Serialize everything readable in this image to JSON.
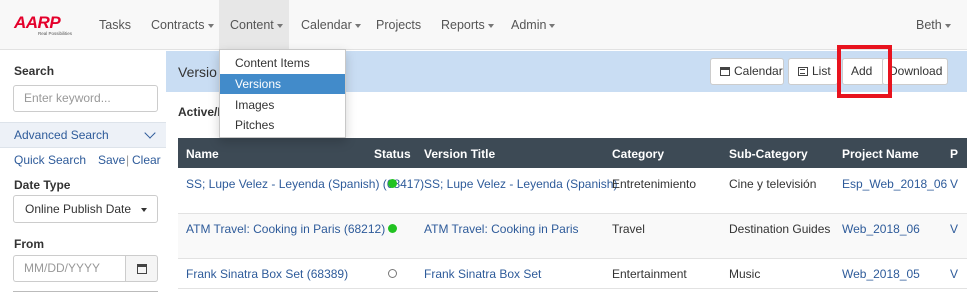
{
  "app": {
    "logo_text": "AARP",
    "logo_tagline": "Real Possibilities"
  },
  "nav": {
    "items": [
      {
        "label": "Tasks",
        "has_caret": false
      },
      {
        "label": "Contracts",
        "has_caret": true
      },
      {
        "label": "Content",
        "has_caret": true,
        "active": true
      },
      {
        "label": "Calendar",
        "has_caret": true
      },
      {
        "label": "Projects",
        "has_caret": false
      },
      {
        "label": "Reports",
        "has_caret": true
      },
      {
        "label": "Admin",
        "has_caret": true
      }
    ],
    "user": {
      "label": "Beth"
    }
  },
  "content_menu": {
    "items": [
      {
        "label": "Content Items"
      },
      {
        "label": "Versions",
        "selected": true
      },
      {
        "label": "Images"
      },
      {
        "label": "Pitches"
      }
    ]
  },
  "sidebar": {
    "search_label": "Search",
    "search_placeholder": "Enter keyword...",
    "advanced_search": "Advanced Search",
    "quick_search": "Quick Search",
    "save": "Save",
    "separator": "|",
    "clear": "Clear",
    "date_type_label": "Date Type",
    "date_type_value": "Online Publish Date",
    "from_label": "From",
    "from_placeholder": "MM/DD/YYYY"
  },
  "main": {
    "title": "Versio",
    "section_label": "Active/I",
    "toolbar": {
      "calendar": "Calendar",
      "list": "List",
      "add": "Add",
      "download": "Download"
    },
    "highlight_color": "#e8131e"
  },
  "table": {
    "columns": [
      "Name",
      "Status",
      "Version Title",
      "Category",
      "Sub-Category",
      "Project Name",
      "P"
    ],
    "rows": [
      {
        "name": "SS; Lupe Velez - Leyenda (Spanish) (68417)",
        "status": "active",
        "version_title": "SS; Lupe Velez - Leyenda (Spanish)",
        "category": "Entretenimiento",
        "sub_category": "Cine y televisión",
        "project_name": "Esp_Web_2018_06",
        "extra": "V"
      },
      {
        "name": "ATM Travel: Cooking in Paris (68212)",
        "status": "active",
        "version_title": "ATM Travel: Cooking in Paris",
        "category": "Travel",
        "sub_category": "Destination Guides",
        "project_name": "Web_2018_06",
        "extra": "V"
      },
      {
        "name": "Frank Sinatra Box Set (68389)",
        "status": "inactive",
        "version_title": "Frank Sinatra Box Set",
        "category": "Entertainment",
        "sub_category": "Music",
        "project_name": "Web_2018_05",
        "extra": "V"
      }
    ]
  }
}
